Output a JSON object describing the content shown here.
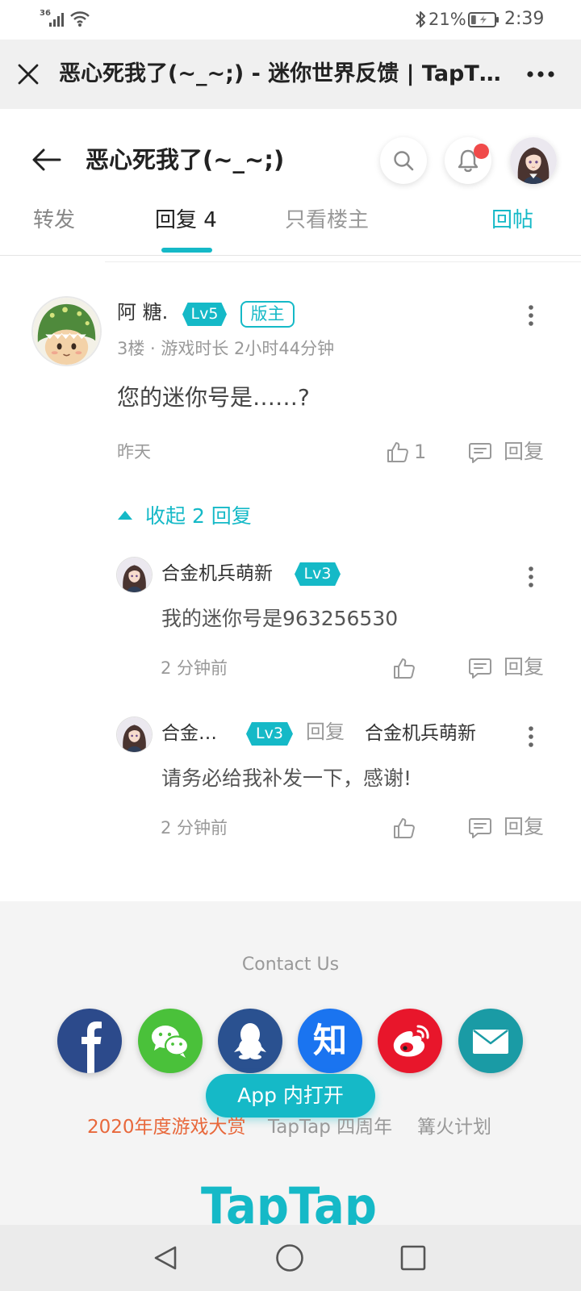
{
  "theme": {
    "accent": "#15b9c7",
    "highlight": "#e8683b",
    "notification_dot": "#f04a4a"
  },
  "status_bar": {
    "network": "36",
    "battery_percent": "21%",
    "battery_level": 0.21,
    "time": "2:39",
    "icons": [
      "signal-icon",
      "wifi-icon",
      "bluetooth-icon",
      "battery-icon"
    ]
  },
  "webview": {
    "title": "恶心死我了(~_~;) - 迷你世界反馈 | TapT…",
    "icons": [
      "close-icon",
      "more-icon"
    ]
  },
  "header": {
    "title": "恶心死我了(~_~;)",
    "icons": [
      "back-arrow-icon",
      "search-icon",
      "bell-icon"
    ],
    "has_notification": true
  },
  "tabs": {
    "items": [
      {
        "label": "转发"
      },
      {
        "label": "回复 4",
        "active": true
      },
      {
        "label": "只看楼主"
      }
    ],
    "reply_post_label": "回帖"
  },
  "comment": {
    "author": "阿 糖.",
    "level": "Lv5",
    "role_badge": "版主",
    "meta": "3楼 · 游戏时长 2小时44分钟",
    "content": "您的迷你号是……?",
    "time": "昨天",
    "like_count": "1",
    "reply_label": "回复"
  },
  "replies_toggle": {
    "label": "收起 2 回复",
    "icon": "triangle-up-icon"
  },
  "replies": [
    {
      "author": "合金机兵萌新",
      "level": "Lv3",
      "content": "我的迷你号是963256530",
      "time": "2 分钟前",
      "reply_label": "回复"
    },
    {
      "author": "合金…",
      "level": "Lv3",
      "reply_to_label": "回复",
      "reply_to": "合金机兵萌新",
      "content": "请务必给我补发一下，感谢!",
      "time": "2 分钟前",
      "reply_label": "回复"
    }
  ],
  "footer": {
    "contact_us": "Contact Us",
    "social": [
      {
        "name": "facebook",
        "icon": "facebook-icon",
        "color": "#2c4a8b"
      },
      {
        "name": "wechat",
        "icon": "wechat-icon",
        "color": "#4ac13a"
      },
      {
        "name": "qq",
        "icon": "qq-icon",
        "color": "#2a5190"
      },
      {
        "name": "zhihu",
        "icon": "zhihu-icon",
        "color": "#1a74f0",
        "glyph": "知"
      },
      {
        "name": "weibo",
        "icon": "weibo-icon",
        "color": "#e8162b"
      },
      {
        "name": "email",
        "icon": "email-icon",
        "color": "#1a9ba5"
      }
    ],
    "open_in_app": "App 内打开",
    "links": [
      "2020年度游戏大赏",
      "TapTap 四周年",
      "篝火计划"
    ],
    "logo_text": "TapTap"
  },
  "nav_bar": {
    "icons": [
      "nav-back-icon",
      "nav-home-icon",
      "nav-recents-icon"
    ]
  }
}
